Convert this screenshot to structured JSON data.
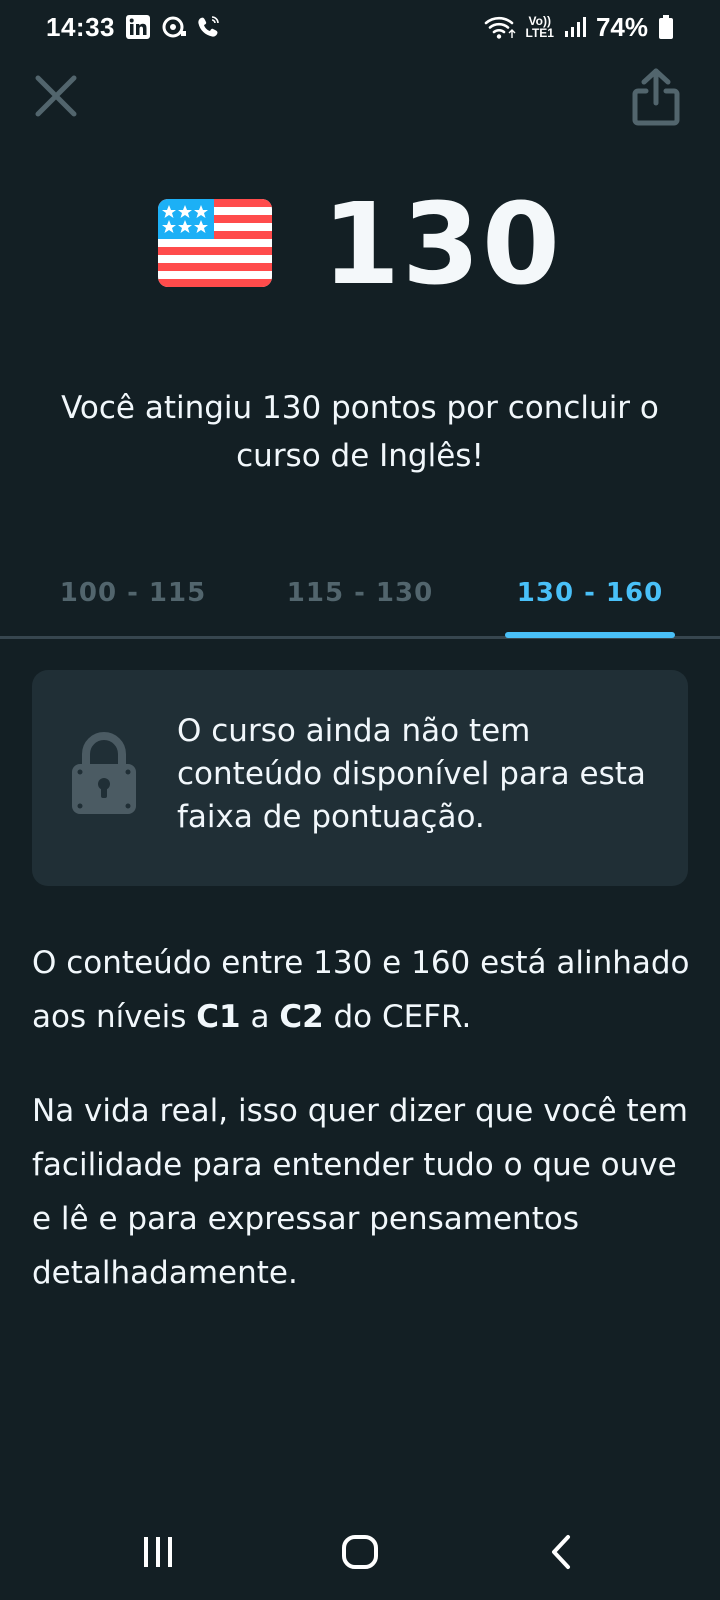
{
  "status_bar": {
    "time": "14:33",
    "battery": "74%",
    "network_label_top": "Vo))",
    "network_label_bottom": "LTE1",
    "icons": [
      "linkedin-icon",
      "cast-icon",
      "wifi-call-icon",
      "wifi-icon",
      "signal-icon",
      "battery-icon"
    ]
  },
  "header": {
    "close_icon": "close-icon",
    "share_icon": "share-icon"
  },
  "score": {
    "flag": "us-flag-icon",
    "value": "130",
    "message": "Você atingiu 130 pontos por concluir o curso de Inglês!"
  },
  "tabs": [
    {
      "label": "100 - 115",
      "active": false
    },
    {
      "label": "115 - 130",
      "active": false
    },
    {
      "label": "130 - 160",
      "active": true
    }
  ],
  "locked_card": {
    "icon": "lock-icon",
    "text": "O curso ainda não tem conteúdo disponível para esta faixa de pontuação."
  },
  "description": {
    "p1_before": "O conteúdo entre 130 e 160 está alinhado aos níveis ",
    "level_from": "C1",
    "p1_middle": " a ",
    "level_to": "C2",
    "p1_after": " do CEFR.",
    "p2": "Na vida real, isso quer dizer que você tem facilidade para entender tudo o que ouve e lê e para expressar pensamentos detalhadamente."
  },
  "nav_bar": {
    "recents_icon": "recents-icon",
    "home_icon": "home-icon",
    "back_icon": "back-icon"
  },
  "colors": {
    "background": "#131f24",
    "card": "#202f36",
    "accent": "#49c0f8",
    "muted": "#52656d",
    "text": "#f1f7fb"
  }
}
